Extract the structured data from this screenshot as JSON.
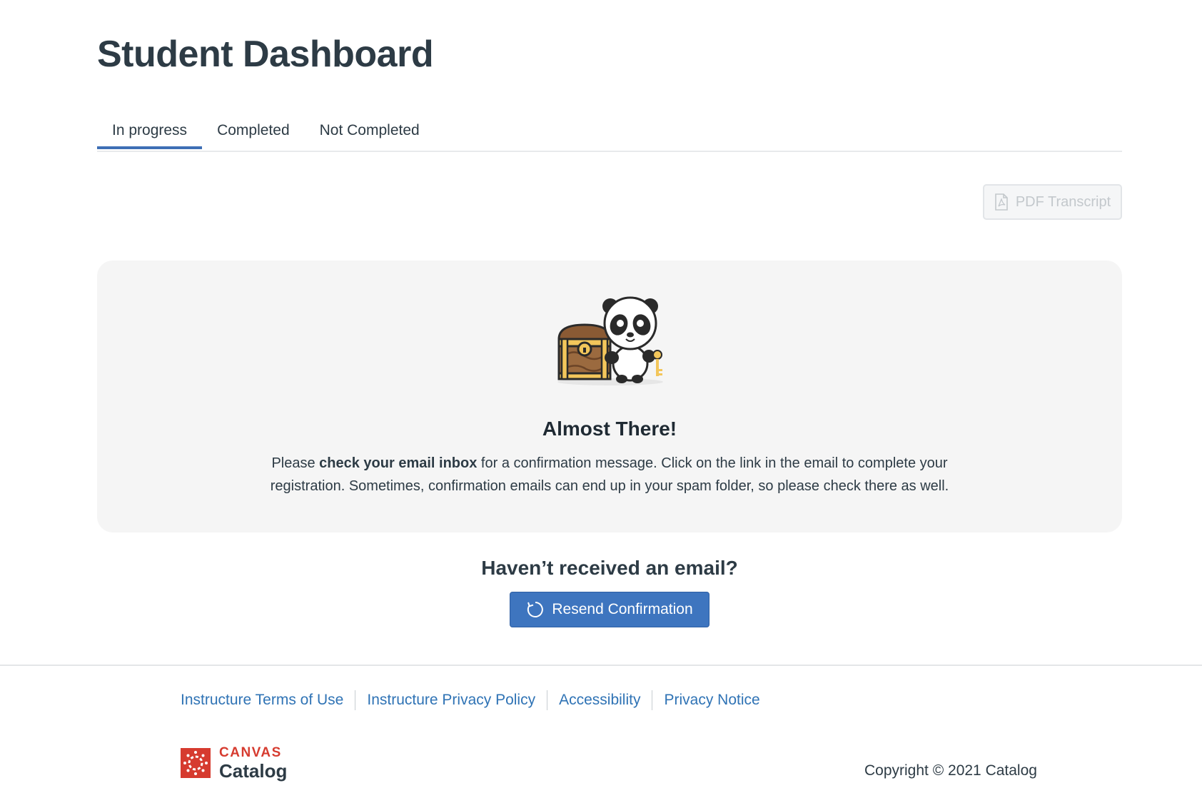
{
  "page": {
    "title": "Student Dashboard"
  },
  "tabs": [
    {
      "label": "In progress",
      "active": true
    },
    {
      "label": "Completed",
      "active": false
    },
    {
      "label": "Not Completed",
      "active": false
    }
  ],
  "toolbar": {
    "pdf_label": "PDF Transcript",
    "pdf_icon": "pdf-file-icon"
  },
  "notice": {
    "title": "Almost There!",
    "text_before": "Please ",
    "text_bold": "check your email inbox",
    "text_after": " for a confirmation message. Click on the link in the email to complete your registration. Sometimes, confirmation emails can end up in your spam folder, so please check there as well."
  },
  "resend": {
    "heading": "Haven’t received an email?",
    "button_label": "Resend Confirmation",
    "button_icon": "refresh-icon"
  },
  "footer": {
    "links": [
      "Instructure Terms of Use",
      "Instructure Privacy Policy",
      "Accessibility",
      "Privacy Notice"
    ],
    "brand_top": "CANVAS",
    "brand_bottom": "Catalog",
    "copyright": "Copyright © 2021 Catalog"
  },
  "colors": {
    "accent": "#3e75bf",
    "link": "#2f73b5",
    "brand_red": "#d63b2f",
    "text": "#2d3b45"
  }
}
